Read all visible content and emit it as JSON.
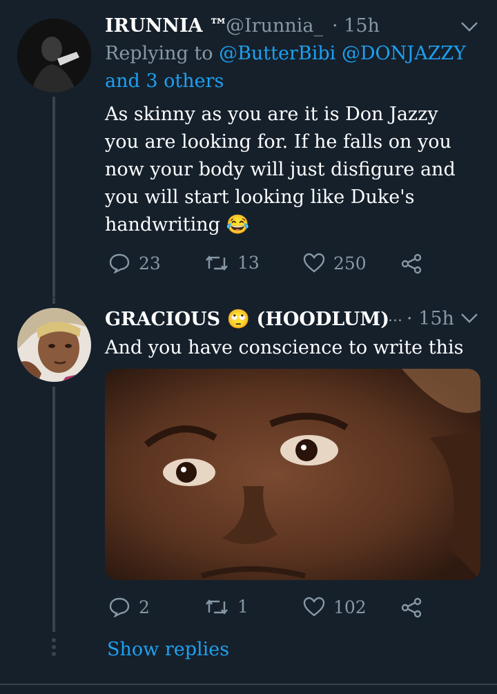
{
  "tweet1": {
    "name": "IRUNNIA ™",
    "handle": "@Irunnia_",
    "time": "· 15h",
    "replying_prefix": "Replying to",
    "reply_user1": "@ButterBibi",
    "reply_user2": "@DONJAZZY",
    "reply_others": "and 3 others",
    "lines": [
      "As skinny as you are it is Don Jazzy",
      "you are looking for. If he falls on you",
      "now your body will just disfigure and",
      "you will start looking like Duke's",
      "handwriting 😂"
    ],
    "replies": "23",
    "retweets": "13",
    "likes": "250"
  },
  "tweet2": {
    "name": "GRACIOUS 🙄 (HOODLUM)",
    "ellipsis": "...",
    "time": "· 15h",
    "text": "And you have conscience to write this",
    "replies": "2",
    "retweets": "1",
    "likes": "102"
  },
  "show_replies": "Show replies",
  "colors": {
    "background": "#15202b",
    "accent": "#1da1f2",
    "muted": "#8899a6"
  }
}
